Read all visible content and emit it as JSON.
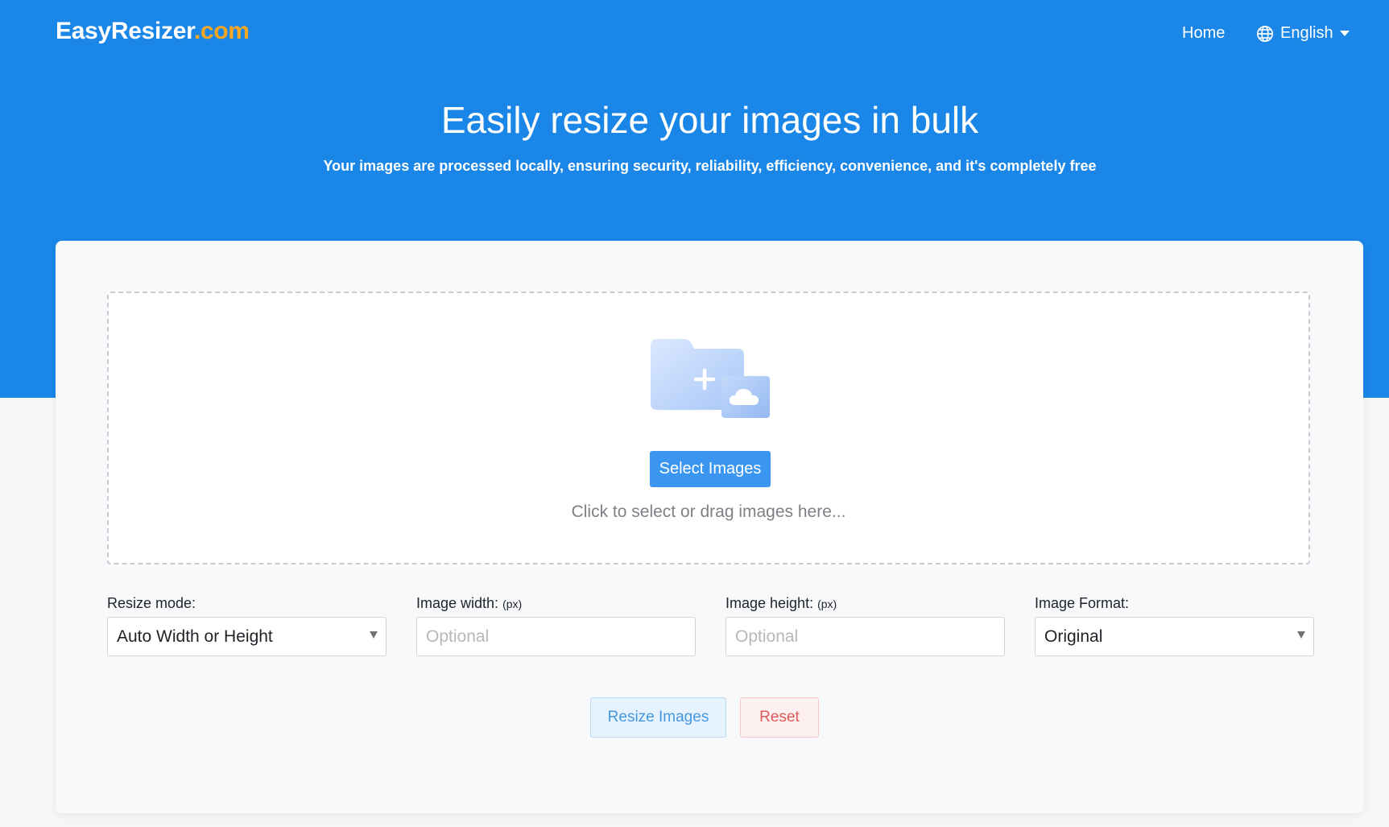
{
  "header": {
    "logo_main": "EasyResizer",
    "logo_tld": ".com",
    "nav_home": "Home",
    "language": "English"
  },
  "hero": {
    "title": "Easily resize your images in bulk",
    "subtitle": "Your images are processed locally, ensuring security, reliability, efficiency, convenience, and it's completely free"
  },
  "upload": {
    "select_button": "Select Images",
    "hint": "Click to select or drag images here..."
  },
  "options": {
    "resize_mode_label": "Resize mode:",
    "resize_mode_value": "Auto Width or Height",
    "width_label": "Image width:",
    "width_unit": "(px)",
    "width_placeholder": "Optional",
    "height_label": "Image height:",
    "height_unit": "(px)",
    "height_placeholder": "Optional",
    "format_label": "Image Format:",
    "format_value": "Original"
  },
  "actions": {
    "resize_button": "Resize Images",
    "reset_button": "Reset"
  },
  "icons": {
    "language": "globe-icon",
    "dropdown": "chevron-down-icon",
    "upload": "folder-add-cloud-icon"
  },
  "colors": {
    "brand_blue": "#1a86e8",
    "logo_accent": "#f5a623",
    "primary_button": "#3a96f0",
    "reset_text": "#e05a5a"
  }
}
